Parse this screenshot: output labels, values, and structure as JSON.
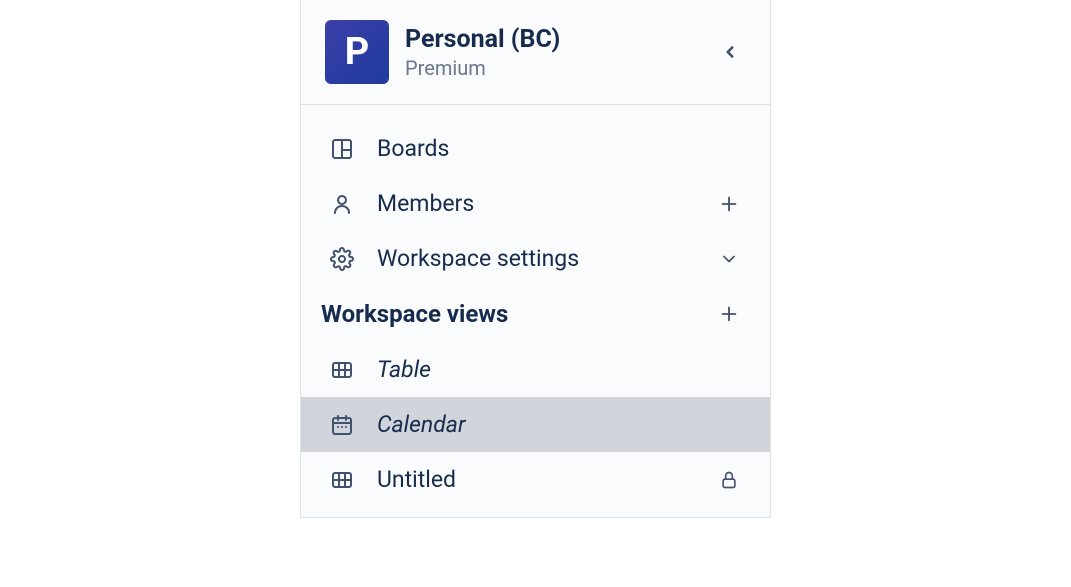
{
  "workspace": {
    "logoLetter": "P",
    "name": "Personal (BC)",
    "plan": "Premium"
  },
  "nav": {
    "boards": "Boards",
    "members": "Members",
    "settings": "Workspace settings"
  },
  "viewsSection": {
    "title": "Workspace views"
  },
  "views": {
    "table": "Table",
    "calendar": "Calendar",
    "untitled": "Untitled"
  }
}
